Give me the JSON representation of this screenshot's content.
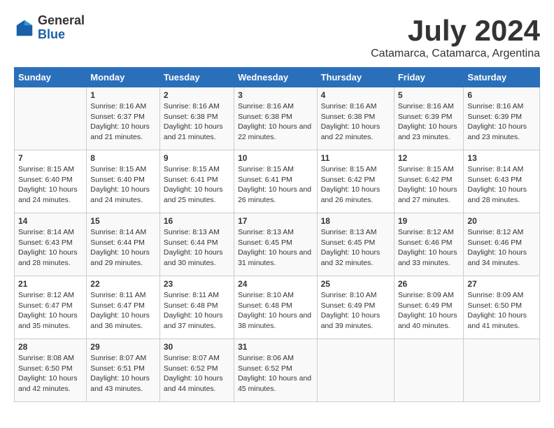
{
  "logo": {
    "general": "General",
    "blue": "Blue"
  },
  "title": "July 2024",
  "location": "Catamarca, Catamarca, Argentina",
  "days_of_week": [
    "Sunday",
    "Monday",
    "Tuesday",
    "Wednesday",
    "Thursday",
    "Friday",
    "Saturday"
  ],
  "weeks": [
    [
      {
        "day": "",
        "content": ""
      },
      {
        "day": "1",
        "content": "Sunrise: 8:16 AM\nSunset: 6:37 PM\nDaylight: 10 hours and 21 minutes."
      },
      {
        "day": "2",
        "content": "Sunrise: 8:16 AM\nSunset: 6:38 PM\nDaylight: 10 hours and 21 minutes."
      },
      {
        "day": "3",
        "content": "Sunrise: 8:16 AM\nSunset: 6:38 PM\nDaylight: 10 hours and 22 minutes."
      },
      {
        "day": "4",
        "content": "Sunrise: 8:16 AM\nSunset: 6:38 PM\nDaylight: 10 hours and 22 minutes."
      },
      {
        "day": "5",
        "content": "Sunrise: 8:16 AM\nSunset: 6:39 PM\nDaylight: 10 hours and 23 minutes."
      },
      {
        "day": "6",
        "content": "Sunrise: 8:16 AM\nSunset: 6:39 PM\nDaylight: 10 hours and 23 minutes."
      }
    ],
    [
      {
        "day": "7",
        "content": "Sunrise: 8:15 AM\nSunset: 6:40 PM\nDaylight: 10 hours and 24 minutes."
      },
      {
        "day": "8",
        "content": "Sunrise: 8:15 AM\nSunset: 6:40 PM\nDaylight: 10 hours and 24 minutes."
      },
      {
        "day": "9",
        "content": "Sunrise: 8:15 AM\nSunset: 6:41 PM\nDaylight: 10 hours and 25 minutes."
      },
      {
        "day": "10",
        "content": "Sunrise: 8:15 AM\nSunset: 6:41 PM\nDaylight: 10 hours and 26 minutes."
      },
      {
        "day": "11",
        "content": "Sunrise: 8:15 AM\nSunset: 6:42 PM\nDaylight: 10 hours and 26 minutes."
      },
      {
        "day": "12",
        "content": "Sunrise: 8:15 AM\nSunset: 6:42 PM\nDaylight: 10 hours and 27 minutes."
      },
      {
        "day": "13",
        "content": "Sunrise: 8:14 AM\nSunset: 6:43 PM\nDaylight: 10 hours and 28 minutes."
      }
    ],
    [
      {
        "day": "14",
        "content": "Sunrise: 8:14 AM\nSunset: 6:43 PM\nDaylight: 10 hours and 28 minutes."
      },
      {
        "day": "15",
        "content": "Sunrise: 8:14 AM\nSunset: 6:44 PM\nDaylight: 10 hours and 29 minutes."
      },
      {
        "day": "16",
        "content": "Sunrise: 8:13 AM\nSunset: 6:44 PM\nDaylight: 10 hours and 30 minutes."
      },
      {
        "day": "17",
        "content": "Sunrise: 8:13 AM\nSunset: 6:45 PM\nDaylight: 10 hours and 31 minutes."
      },
      {
        "day": "18",
        "content": "Sunrise: 8:13 AM\nSunset: 6:45 PM\nDaylight: 10 hours and 32 minutes."
      },
      {
        "day": "19",
        "content": "Sunrise: 8:12 AM\nSunset: 6:46 PM\nDaylight: 10 hours and 33 minutes."
      },
      {
        "day": "20",
        "content": "Sunrise: 8:12 AM\nSunset: 6:46 PM\nDaylight: 10 hours and 34 minutes."
      }
    ],
    [
      {
        "day": "21",
        "content": "Sunrise: 8:12 AM\nSunset: 6:47 PM\nDaylight: 10 hours and 35 minutes."
      },
      {
        "day": "22",
        "content": "Sunrise: 8:11 AM\nSunset: 6:47 PM\nDaylight: 10 hours and 36 minutes."
      },
      {
        "day": "23",
        "content": "Sunrise: 8:11 AM\nSunset: 6:48 PM\nDaylight: 10 hours and 37 minutes."
      },
      {
        "day": "24",
        "content": "Sunrise: 8:10 AM\nSunset: 6:48 PM\nDaylight: 10 hours and 38 minutes."
      },
      {
        "day": "25",
        "content": "Sunrise: 8:10 AM\nSunset: 6:49 PM\nDaylight: 10 hours and 39 minutes."
      },
      {
        "day": "26",
        "content": "Sunrise: 8:09 AM\nSunset: 6:49 PM\nDaylight: 10 hours and 40 minutes."
      },
      {
        "day": "27",
        "content": "Sunrise: 8:09 AM\nSunset: 6:50 PM\nDaylight: 10 hours and 41 minutes."
      }
    ],
    [
      {
        "day": "28",
        "content": "Sunrise: 8:08 AM\nSunset: 6:50 PM\nDaylight: 10 hours and 42 minutes."
      },
      {
        "day": "29",
        "content": "Sunrise: 8:07 AM\nSunset: 6:51 PM\nDaylight: 10 hours and 43 minutes."
      },
      {
        "day": "30",
        "content": "Sunrise: 8:07 AM\nSunset: 6:52 PM\nDaylight: 10 hours and 44 minutes."
      },
      {
        "day": "31",
        "content": "Sunrise: 8:06 AM\nSunset: 6:52 PM\nDaylight: 10 hours and 45 minutes."
      },
      {
        "day": "",
        "content": ""
      },
      {
        "day": "",
        "content": ""
      },
      {
        "day": "",
        "content": ""
      }
    ]
  ]
}
